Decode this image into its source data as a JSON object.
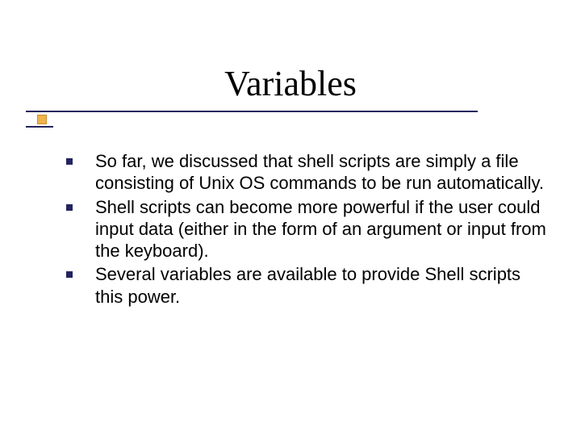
{
  "title": "Variables",
  "bullets": [
    "So far, we discussed that shell scripts are simply a file consisting of Unix OS commands to be run automatically.",
    "Shell scripts can become more powerful if the user could input data (either in the form of an argument or input from the keyboard).",
    "Several variables are available to provide Shell scripts this power."
  ],
  "colors": {
    "rule": "#23245e",
    "accent": "#f0b24d",
    "bullet": "#23245e"
  }
}
